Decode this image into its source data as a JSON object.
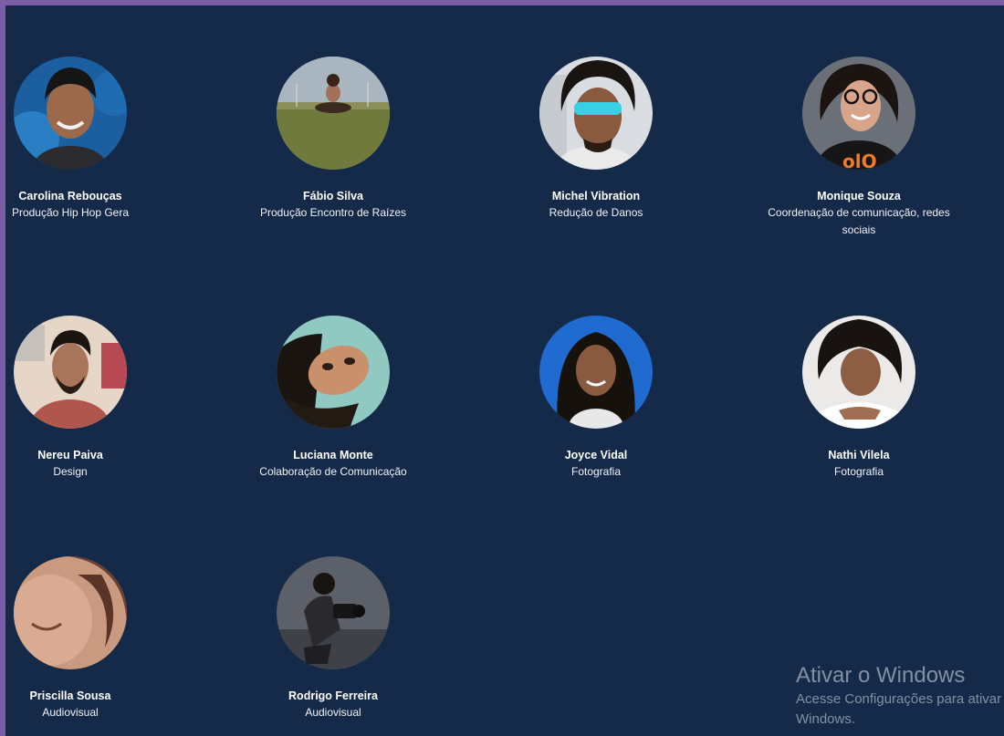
{
  "team": [
    {
      "name": "Carolina Rebouças",
      "role": "Produção Hip Hop Gera"
    },
    {
      "name": "Fábio Silva",
      "role": "Produção Encontro de Raízes"
    },
    {
      "name": "Michel Vibration",
      "role": "Redução de Danos"
    },
    {
      "name": "Monique Souza",
      "role": "Coordenação de comunicação, redes sociais"
    },
    {
      "name": "Nereu Paiva",
      "role": "Design"
    },
    {
      "name": "Luciana Monte",
      "role": "Colaboração de Comunicação"
    },
    {
      "name": "Joyce Vidal",
      "role": "Fotografia"
    },
    {
      "name": "Nathi Vilela",
      "role": "Fotografia"
    },
    {
      "name": "Priscilla Sousa",
      "role": "Audiovisual"
    },
    {
      "name": "Rodrigo Ferreira",
      "role": "Audiovisual"
    }
  ],
  "windows_activation": {
    "title": "Ativar o Windows",
    "line1": "Acesse Configurações para ativar o",
    "line2": "Windows."
  },
  "colors": {
    "page_background": "#152a48",
    "outer_border": "#7b5ea7",
    "text": "#ffffff"
  }
}
